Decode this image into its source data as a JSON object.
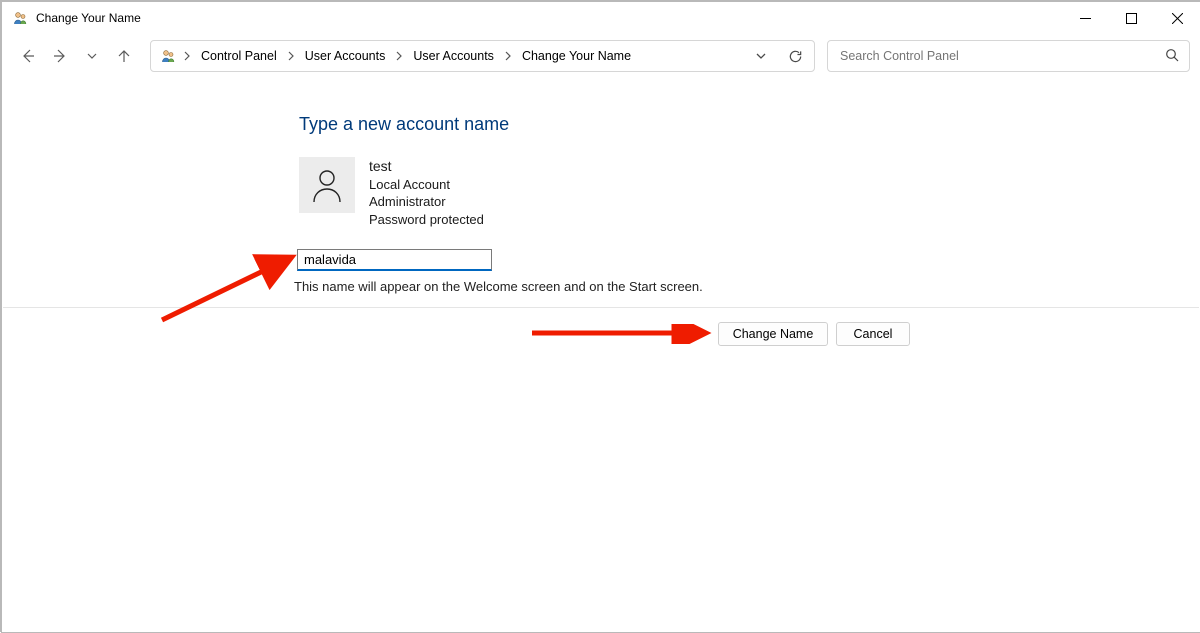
{
  "window": {
    "title": "Change Your Name"
  },
  "breadcrumb": {
    "root": "Control Panel",
    "level1": "User Accounts",
    "level2": "User Accounts",
    "level3": "Change Your Name"
  },
  "search": {
    "placeholder": "Search Control Panel"
  },
  "page": {
    "heading": "Type a new account name",
    "hint": "This name will appear on the Welcome screen and on the Start screen."
  },
  "account": {
    "username": "test",
    "type": "Local Account",
    "role": "Administrator",
    "protection": "Password protected"
  },
  "input": {
    "value": "malavida"
  },
  "buttons": {
    "change": "Change Name",
    "cancel": "Cancel"
  }
}
